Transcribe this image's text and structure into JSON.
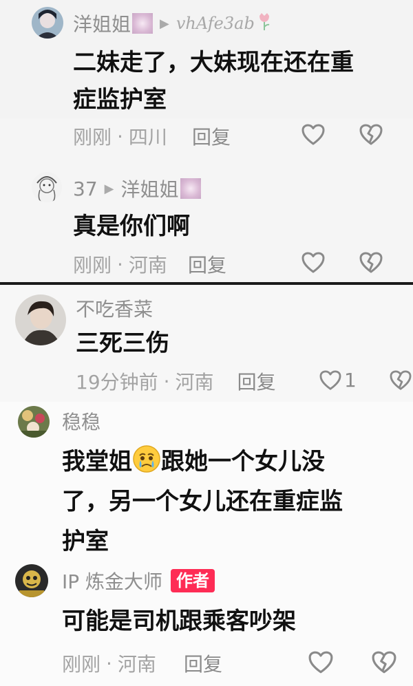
{
  "comments": [
    {
      "user": "洋姐姐",
      "reply_to": "vhAfe3ab",
      "text_lines": [
        "二妹走了，大妹现在还在重",
        "症监护室"
      ],
      "time": "刚刚",
      "location": "四川",
      "reply_label": "回复"
    },
    {
      "user": "37",
      "reply_to": "洋姐姐",
      "text_lines": [
        "真是你们啊"
      ],
      "time": "刚刚",
      "location": "河南",
      "reply_label": "回复"
    },
    {
      "user": "不吃香菜",
      "text_lines": [
        "三死三伤"
      ],
      "time": "19分钟前",
      "location": "河南",
      "reply_label": "回复",
      "like_count": "1"
    },
    {
      "user": "稳稳",
      "text_lines": [
        "我堂姐",
        "跟她一个女儿没",
        "了，另一个女儿还在重症监",
        "护室"
      ]
    },
    {
      "user": "IP 炼金大师",
      "badge": "作者",
      "text_lines": [
        "可能是司机跟乘客吵架"
      ],
      "time": "刚刚",
      "location": "河南",
      "reply_label": "回复"
    }
  ],
  "separator": "·",
  "icons": {
    "like": "heart-outline-icon",
    "dislike": "broken-heart-icon",
    "reply_arrow": "triangle-right-icon",
    "emoji": "crying-face-emoji"
  },
  "colors": {
    "text_main": "#111111",
    "text_meta": "#a3a3a3",
    "author_badge": "#fe2c55"
  }
}
